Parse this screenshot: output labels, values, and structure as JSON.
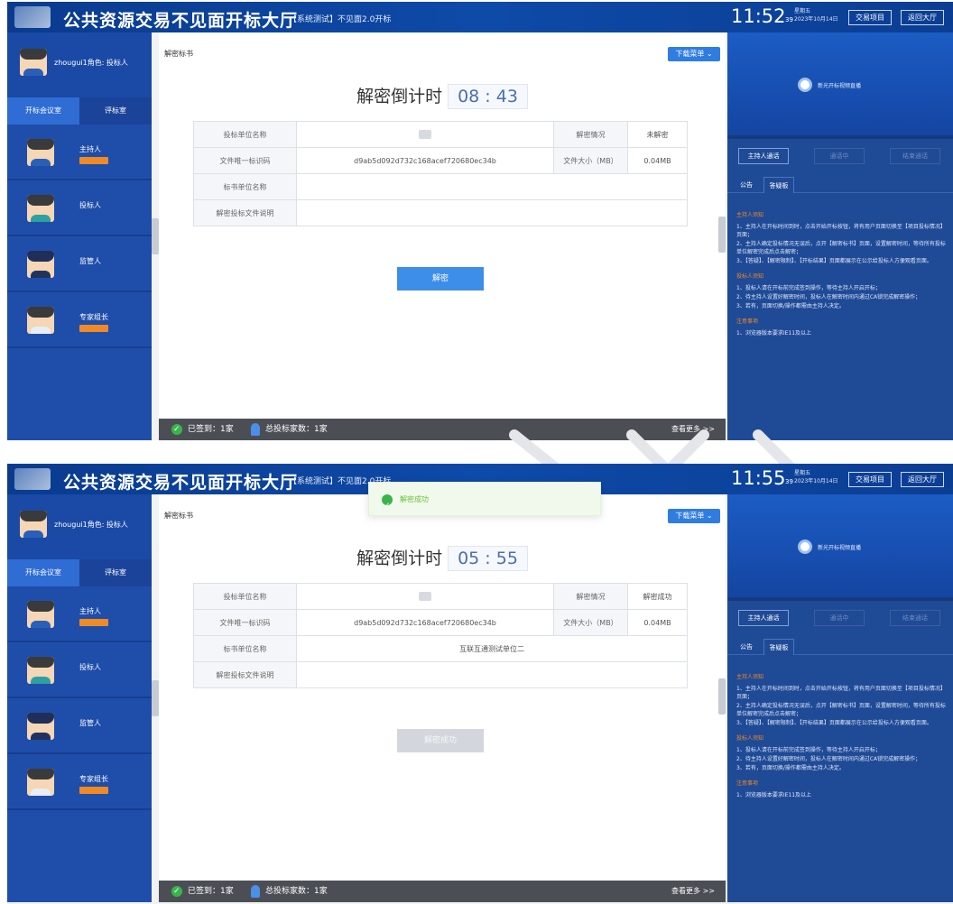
{
  "screens": [
    {
      "header": {
        "title": "公共资源交易不见面开标大厅",
        "tag": "【系统测试】不见面2.0开标",
        "time": "11:52",
        "seconds": "39",
        "date_line1": "星期五",
        "date_line2": "2023年10月14日",
        "btn_a": "交易项目",
        "btn_b": "返回大厅"
      },
      "sidebar": {
        "user": "zhougui1角色: 投标人",
        "tab_active": "开标会议室",
        "tab_other": "评标室",
        "roles": [
          {
            "label": "主持人",
            "badge": true
          },
          {
            "label": "投标人",
            "badge": false
          },
          {
            "label": "监管人",
            "badge": false
          },
          {
            "label": "专家组长",
            "badge": true
          }
        ]
      },
      "main": {
        "section_label": "解密标书",
        "menu_btn": "下载菜单 ⌄",
        "countdown_label": "解密倒计时",
        "countdown_value": "08 : 43",
        "table": {
          "r1_label": "投标单位名称",
          "r1_status_label": "解密情况",
          "r1_status_value": "未解密",
          "r2_label": "文件唯一标识码",
          "r2_value": "d9ab5d092d732c168acef720680ec34b",
          "r2_size_label": "文件大小（MB）",
          "r2_size_value": "0.04MB",
          "r3_label": "标书单位名称",
          "r3_value": "",
          "r4_label": "解密投标文件说明",
          "r4_value": ""
        },
        "action_btn": "解密",
        "status": {
          "signed": "已签到：1家",
          "bidders": "总投标家数：1家",
          "more": "查看更多 >>"
        }
      },
      "right": {
        "video_text": "新光开标视频直播",
        "btn1": "主持人通话",
        "btn2": "通话中",
        "btn3": "结束通话",
        "tab1": "公告",
        "tab2": "答疑板",
        "h1": "主持人须知",
        "t1": "1、主持人在开标时间到时，点击开始开标按钮，将有用户页面切换至【项目投标情况】页面；",
        "t2": "2、主持人确定投标情况无误后，点开【解密标书】页面，设置解密时间，等待所有投标单位解密完成后点击解密；",
        "t3": "3、【答疑】、【解密限制】、【开标结果】页面都展示在公示给投标人方便观看页面。",
        "h2": "投标人须知",
        "t4": "1、投标人请在开标前完成签到操作，等待主持人开启开标；",
        "t5": "2、待主持人设置好解密时间，投标人在解密时间内通过CA锁完成解密操作；",
        "t6": "3、若有，页面切换/操作都需由主持人决定。",
        "h3": "注意事项",
        "t7": "1、浏览器版本要求IE11及以上"
      }
    },
    {
      "header": {
        "title": "公共资源交易不见面开标大厅",
        "tag": "【系统测试】不见面2.0开标",
        "time": "11:55",
        "seconds": "39",
        "date_line1": "星期五",
        "date_line2": "2023年10月14日",
        "btn_a": "交易项目",
        "btn_b": "返回大厅"
      },
      "toast": "解密成功",
      "sidebar": {
        "user": "zhougui1角色: 投标人",
        "tab_active": "开标会议室",
        "tab_other": "评标室",
        "roles": [
          {
            "label": "主持人",
            "badge": true
          },
          {
            "label": "投标人",
            "badge": false
          },
          {
            "label": "监管人",
            "badge": false
          },
          {
            "label": "专家组长",
            "badge": true
          }
        ]
      },
      "main": {
        "section_label": "解密标书",
        "menu_btn": "下载菜单 ⌄",
        "countdown_label": "解密倒计时",
        "countdown_value": "05 : 55",
        "table": {
          "r1_label": "投标单位名称",
          "r1_status_label": "解密情况",
          "r1_status_value": "解密成功",
          "r2_label": "文件唯一标识码",
          "r2_value": "d9ab5d092d732c168acef720680ec34b",
          "r2_size_label": "文件大小（MB）",
          "r2_size_value": "0.04MB",
          "r3_label": "标书单位名称",
          "r3_value": "互联互通测试单位二",
          "r4_label": "解密投标文件说明",
          "r4_value": ""
        },
        "action_btn": "解密成功",
        "status": {
          "signed": "已签到：1家",
          "bidders": "总投标家数：1家",
          "more": "查看更多 >>"
        }
      },
      "right": {
        "video_text": "新光开标视频直播",
        "btn1": "主持人通话",
        "btn2": "通话中",
        "btn3": "结束通话",
        "tab1": "公告",
        "tab2": "答疑板",
        "h1": "主持人须知",
        "t1": "1、主持人在开标时间到时，点击开始开标按钮，将有用户页面切换至【项目投标情况】页面；",
        "t2": "2、主持人确定投标情况无误后，点开【解密标书】页面，设置解密时间，等待所有投标单位解密完成后点击解密；",
        "t3": "3、【答疑】、【解密限制】、【开标结果】页面都展示在公示给投标人方便观看页面。",
        "h2": "投标人须知",
        "t4": "1、投标人请在开标前完成签到操作，等待主持人开启开标；",
        "t5": "2、待主持人设置好解密时间，投标人在解密时间内通过CA锁完成解密操作；",
        "t6": "3、若有，页面切换/操作都需由主持人决定。",
        "h3": "注意事项",
        "t7": "1、浏览器版本要求IE11及以上"
      }
    }
  ],
  "colors": {
    "header": "#0e4aa8",
    "sidebar": "#1f4eaa",
    "accent": "#3d8ee8",
    "badge": "#f08a24",
    "success": "#39b54a"
  }
}
